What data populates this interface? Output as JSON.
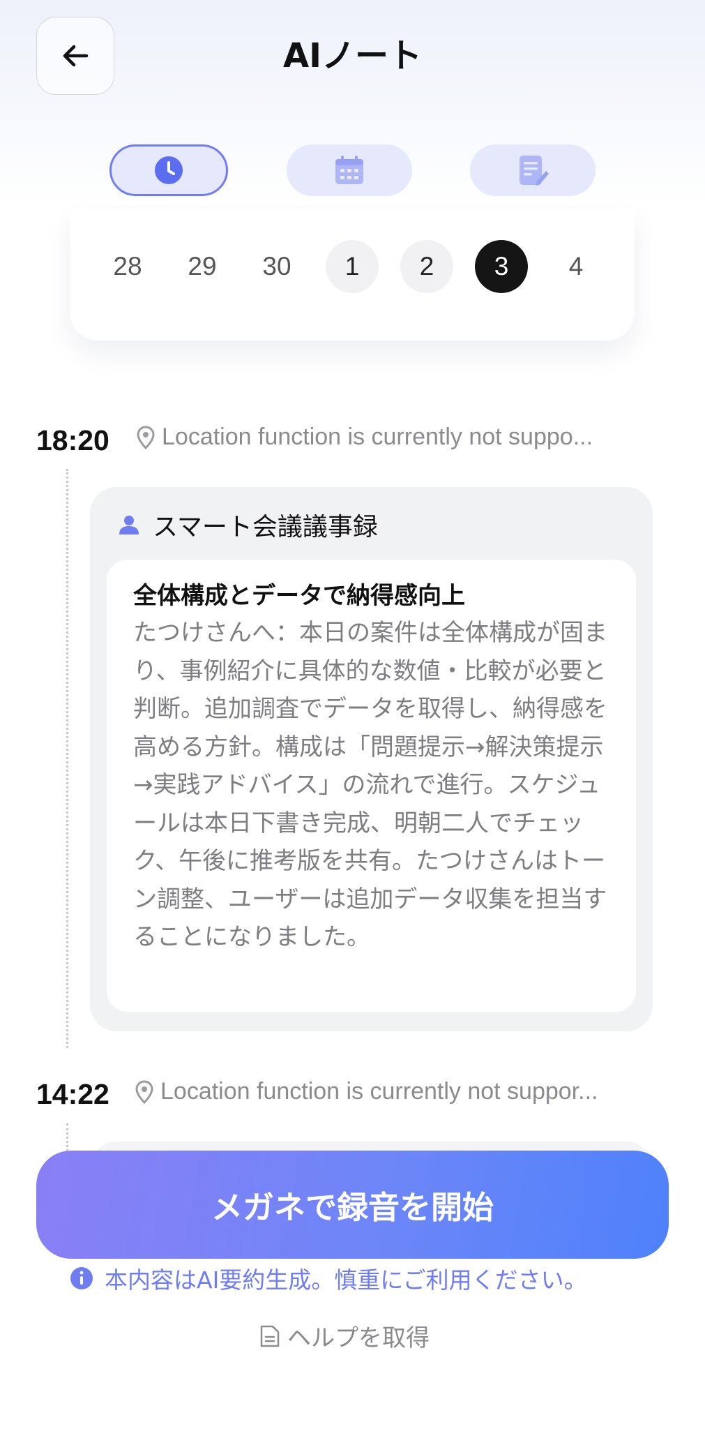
{
  "header": {
    "title": "AIノート",
    "tabs": [
      {
        "icon": "clock-icon",
        "active": true
      },
      {
        "icon": "calendar-icon",
        "active": false
      },
      {
        "icon": "note-edit-icon",
        "active": false
      }
    ]
  },
  "calendar": {
    "days": [
      "28",
      "29",
      "30",
      "1",
      "2",
      "3",
      "4"
    ],
    "selected": "3"
  },
  "entries": [
    {
      "time": "18:20",
      "location": "Location function is currently not suppo...",
      "source_label": "スマート会議議事録",
      "title": "全体構成とデータで納得感向上",
      "body": "たつけさんへ：本日の案件は全体構成が固まり、事例紹介に具体的な数値・比較が必要と判断。追加調査でデータを取得し、納得感を高める方針。構成は「問題提示→解決策提示→実践アドバイス」の流れで進行。スケジュールは本日下書き完成、明朝二人でチェック、午後に推考版を共有。たつけさんはトーン調整、ユーザーは追加データ収集を担当することになりました。"
    },
    {
      "time": "14:22",
      "location": "Location function is currently not suppor..."
    }
  ],
  "footer": {
    "start_button": "メガネで録音を開始",
    "notice": "本内容はAI要約生成。慎重にご利用ください。",
    "help": "ヘルプを取得"
  },
  "colors": {
    "accent": "#6f7df0",
    "button_gradient_start": "#8a7ff5",
    "button_gradient_end": "#4f81fb",
    "selected_day": "#151515"
  }
}
